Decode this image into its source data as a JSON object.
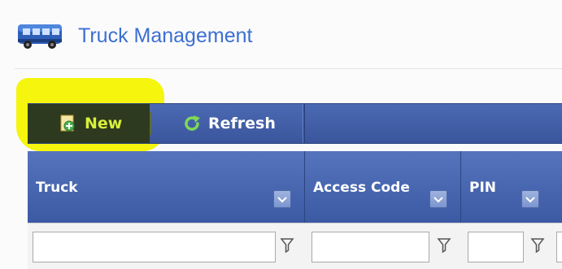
{
  "header": {
    "title": "Truck Management",
    "icon": "truck-icon"
  },
  "toolbar": {
    "new_label": "New",
    "refresh_label": "Refresh",
    "new_icon": "new-document-icon",
    "refresh_icon": "refresh-icon"
  },
  "grid": {
    "columns": [
      {
        "label": "Truck"
      },
      {
        "label": "Access Code"
      },
      {
        "label": "PIN"
      }
    ],
    "filter_icon": "filter-funnel-icon"
  },
  "colors": {
    "title": "#3b6fd3",
    "toolbar": "#4262aa",
    "highlight": "#f4f400",
    "new_button_text": "#d8ef3a"
  }
}
